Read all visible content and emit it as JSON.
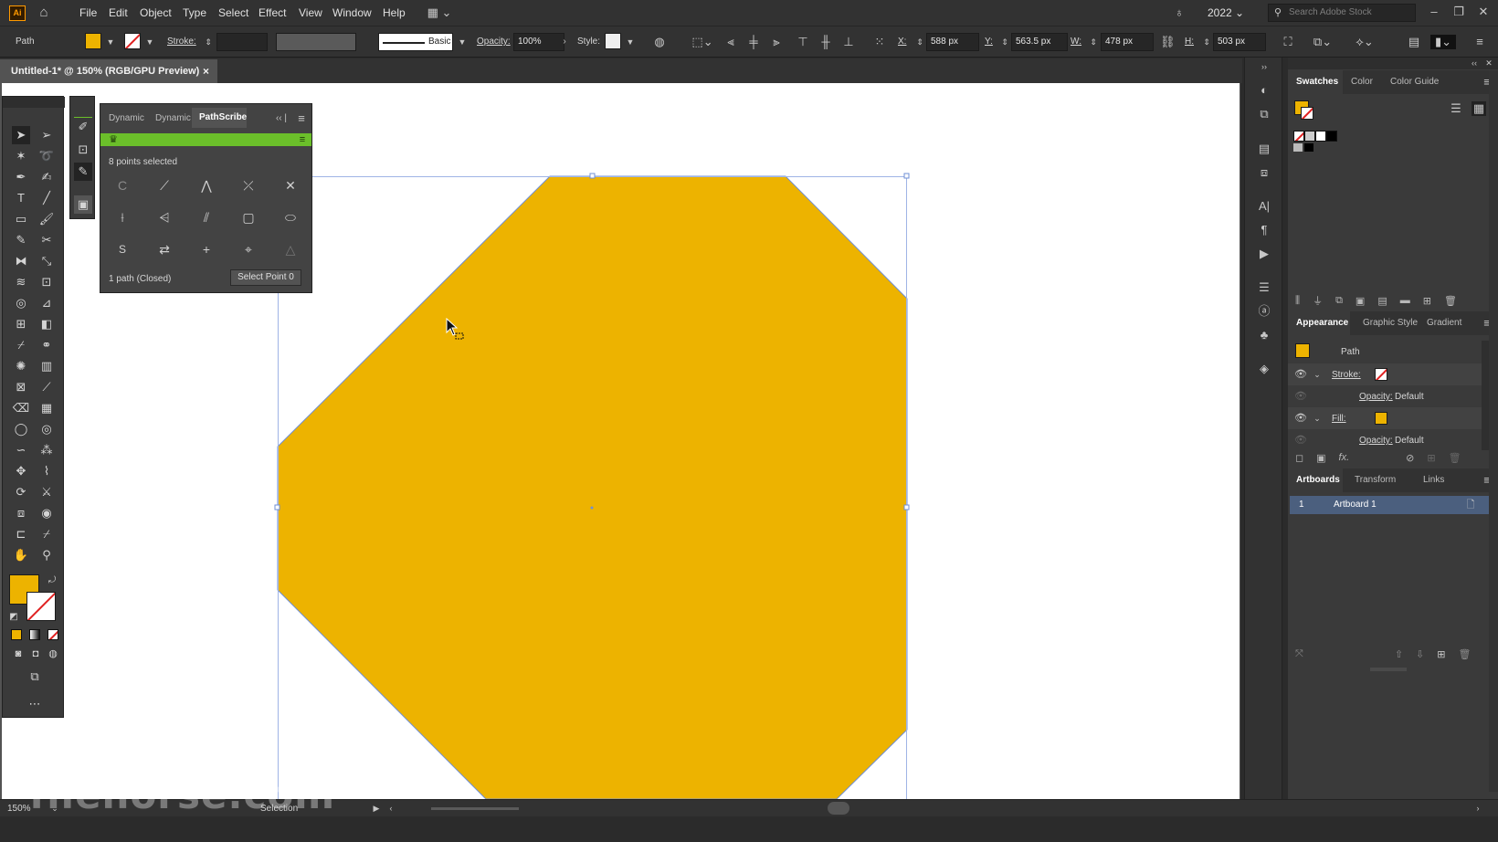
{
  "app": {
    "logo": "Ai",
    "version": "2022",
    "search_placeholder": "Search Adobe Stock"
  },
  "menu": [
    "File",
    "Edit",
    "Object",
    "Type",
    "Select",
    "Effect",
    "View",
    "Window",
    "Help"
  ],
  "control": {
    "object_label": "Path",
    "stroke_label": "Stroke:",
    "brush_label": "Basic",
    "opacity_label": "Opacity:",
    "opacity_value": "100%",
    "style_label": "Style:",
    "x_label": "X:",
    "x_value": "588 px",
    "y_label": "Y:",
    "y_value": "563.5 px",
    "w_label": "W:",
    "w_value": "478 px",
    "h_label": "H:",
    "h_value": "503 px"
  },
  "document": {
    "tab_title": "Untitled-1* @ 150% (RGB/GPU Preview)",
    "close": "×"
  },
  "pathscribe": {
    "tabs": [
      "Dynamic",
      "Dynamic",
      "PathScribe"
    ],
    "active_tab": 2,
    "selection_info": "8 points selected",
    "path_info": "1 path (Closed)",
    "select_point_button": "Select Point 0"
  },
  "swatches": {
    "tabs": [
      "Swatches",
      "Color",
      "Color Guide"
    ]
  },
  "appearance": {
    "tabs": [
      "Appearance",
      "Graphic Style",
      "Gradient"
    ],
    "object": "Path",
    "stroke_label": "Stroke:",
    "stroke_opacity_label": "Opacity:",
    "stroke_opacity_value": "Default",
    "fill_label": "Fill:",
    "fill_opacity_label": "Opacity:",
    "fill_opacity_value": "Default",
    "fx_label": "fx."
  },
  "artboards": {
    "tabs": [
      "Artboards",
      "Transform",
      "Links"
    ],
    "items": [
      {
        "num": "1",
        "name": "Artboard 1"
      }
    ]
  },
  "status": {
    "zoom": "150%",
    "tool": "Selection",
    "watermark": "filehorse.com"
  },
  "colors": {
    "fill": "#edb300",
    "accent_green": "#6bbf2a",
    "selection": "#6f8fd6"
  }
}
